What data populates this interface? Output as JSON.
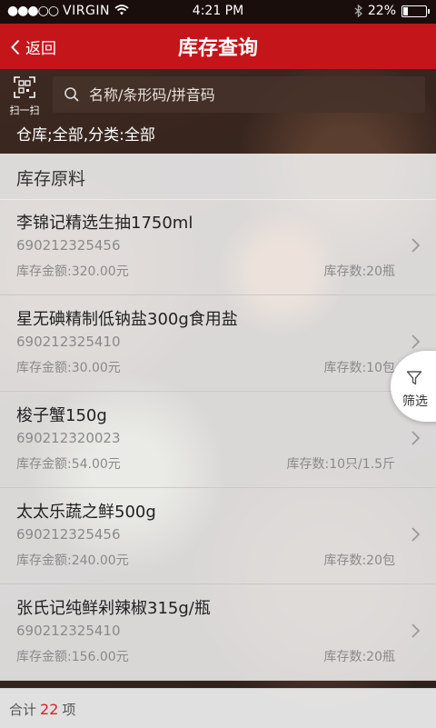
{
  "status": {
    "signal_dots": "●●●○○",
    "carrier": "VIRGIN",
    "time": "4:21 PM",
    "battery": "22%",
    "battery_level": 0.22
  },
  "nav": {
    "back_label": "返回",
    "title": "库存查询"
  },
  "search": {
    "scan_label": "扫一扫",
    "placeholder": "名称/条形码/拼音码",
    "filter_text": "仓库;全部,分类:全部"
  },
  "section_title": "库存原料",
  "items": [
    {
      "name": "李锦记精选生抽1750ml",
      "code": "690212325456",
      "amount": "库存金额:320.00元",
      "qty": "库存数:20瓶"
    },
    {
      "name": "星无碘精制低钠盐300g食用盐",
      "code": "690212325410",
      "amount": "库存金额:30.00元",
      "qty": "库存数:10包"
    },
    {
      "name": "梭子蟹150g",
      "code": "690212320023",
      "amount": "库存金额:54.00元",
      "qty": "库存数:10只/1.5斤"
    },
    {
      "name": "太太乐蔬之鲜500g",
      "code": "690212325456",
      "amount": "库存金额:240.00元",
      "qty": "库存数:20包"
    },
    {
      "name": "张氏记纯鲜剁辣椒315g/瓶",
      "code": "690212325410",
      "amount": "库存金额:156.00元",
      "qty": "库存数:20瓶"
    }
  ],
  "filter_button": "筛选",
  "footer": {
    "prefix": "合计",
    "count": "22",
    "suffix": "项"
  },
  "colors": {
    "nav_red": "#c4151b",
    "count_red": "#d81e28"
  }
}
